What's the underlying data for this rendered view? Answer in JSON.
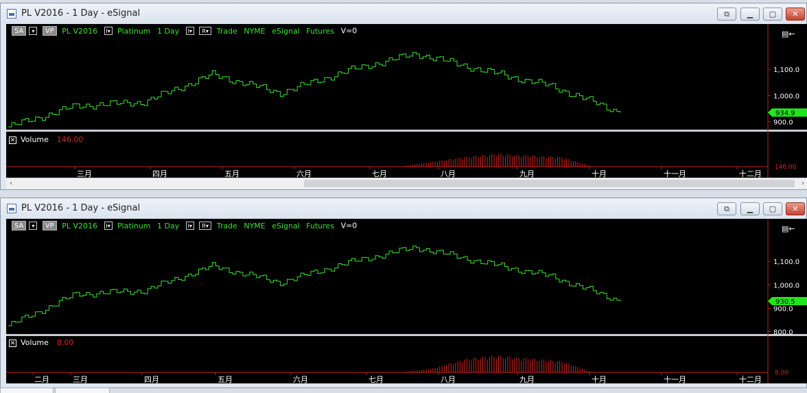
{
  "windows": [
    {
      "id": "top",
      "title": "PL V2016 - 1 Day - eSignal",
      "legend": {
        "sa": "SA",
        "vp": "VP",
        "symbol": "PL V2016",
        "instrument": "Platinum",
        "interval": "1 Day",
        "r_label": "R",
        "type": "Trade",
        "exchange": "NYME",
        "source": "eSignal",
        "market": "Futures",
        "v": "V=0"
      },
      "price_labels": [
        "1,100.0",
        "1,000.0",
        "900.0"
      ],
      "last_price": "934.9",
      "volume": {
        "label": "Volume",
        "value": "146.00",
        "badge": "146.00"
      },
      "months": [
        "三月",
        "四月",
        "五月",
        "六月",
        "七月",
        "八月",
        "九月",
        "十月",
        "十一月",
        "十二月"
      ],
      "has_scrollbar": true
    },
    {
      "id": "bottom",
      "title": "PL V2016 - 1 Day - eSignal",
      "legend": {
        "sa": "SA",
        "vp": "VP",
        "symbol": "PL V2016",
        "instrument": "Platinum",
        "interval": "1 Day",
        "r_label": "R",
        "type": "Trade",
        "exchange": "NYME",
        "source": "eSignal",
        "market": "Futures",
        "v": "V=0"
      },
      "price_labels": [
        "1,100.0",
        "1,000.0",
        "900.0",
        "800.0"
      ],
      "last_price": "930.5",
      "volume": {
        "label": "Volume",
        "value": "8.00",
        "badge": "8.00"
      },
      "months": [
        "二月",
        "三月",
        "四月",
        "五月",
        "六月",
        "七月",
        "八月",
        "九月",
        "十月",
        "十一月",
        "十二月"
      ],
      "has_scrollbar": false
    }
  ],
  "colors": {
    "price": "#37e52b",
    "volume": "#e02020",
    "last_bg": "#22e61c",
    "axis": "#c62020"
  },
  "chart_data": [
    {
      "type": "line",
      "title": "PL V2016 - 1 Day - eSignal",
      "x": [
        "Feb",
        "Mar",
        "Apr",
        "May",
        "Jun",
        "Jul",
        "Aug",
        "Sep",
        "Oct",
        "Nov"
      ],
      "series": [
        {
          "name": "PL V2016",
          "values": [
            880,
            960,
            975,
            1080,
            1010,
            1095,
            1160,
            1095,
            1035,
            934.9
          ]
        }
      ],
      "ylim": [
        880,
        1200
      ],
      "volume": [
        0,
        0,
        0,
        0,
        30,
        60,
        80,
        70,
        60,
        0
      ]
    },
    {
      "type": "line",
      "title": "PL V2016 - 1 Day - eSignal",
      "x": [
        "Feb",
        "Mar",
        "Apr",
        "May",
        "Jun",
        "Jul",
        "Aug",
        "Sep",
        "Oct",
        "Nov"
      ],
      "series": [
        {
          "name": "PL V2016",
          "values": [
            825,
            960,
            975,
            1080,
            1010,
            1095,
            1160,
            1095,
            1035,
            930.5
          ]
        }
      ],
      "ylim": [
        790,
        1200
      ],
      "volume": [
        0,
        0,
        0,
        0,
        20,
        70,
        90,
        75,
        60,
        0
      ]
    }
  ]
}
